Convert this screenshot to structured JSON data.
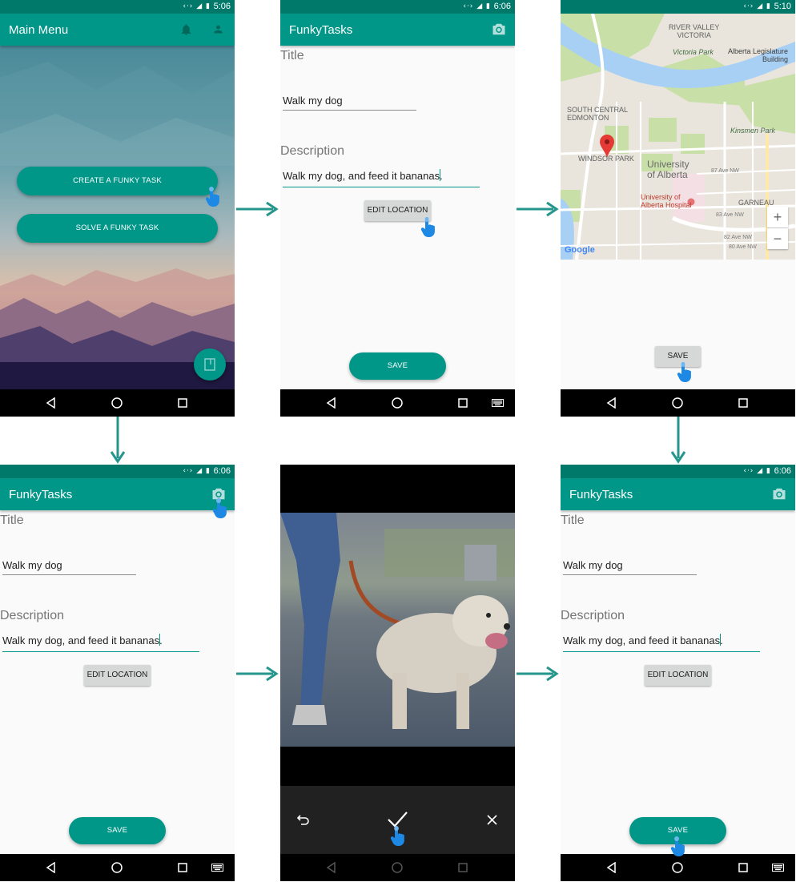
{
  "status": {
    "time_main_menu": "5:06",
    "time_task": "6:06",
    "time_map": "5:10"
  },
  "main_menu": {
    "title": "Main Menu",
    "bell_icon": "bell-icon",
    "account_icon": "account-icon",
    "create_label": "CREATE A FUNKY TASK",
    "solve_label": "SOLVE A FUNKY TASK",
    "fab_icon": "book-icon"
  },
  "task_form": {
    "app_title": "FunkyTasks",
    "camera_icon": "camera-icon",
    "title_label": "Title",
    "title_value": "Walk my dog",
    "description_label": "Description",
    "description_value": "Walk my dog, and feed it bananas.",
    "edit_location_label": "EDIT LOCATION",
    "save_label": "SAVE"
  },
  "map": {
    "labels": {
      "river_valley": "RIVER VALLEY\nVICTORIA",
      "victoria_park": "Victoria Park",
      "legislature": "Alberta Legislature\nBuilding",
      "south_central": "SOUTH CENTRAL\nEDMONTON",
      "kinsmen": "Kinsmen Park",
      "windsor": "WINDSOR PARK",
      "university": "University\nof Alberta",
      "hospital": "University of\nAlberta Hospital",
      "garneau": "GARNEAU",
      "ave87": "87 Ave NW",
      "ave83": "83 Ave NW",
      "ave82": "82 Ave NW",
      "ave80": "80 Ave NW",
      "google": "Google"
    },
    "zoom_in": "+",
    "zoom_out": "−",
    "save_label": "SAVE"
  },
  "camera": {
    "retake_icon": "undo-icon",
    "confirm_icon": "check-icon",
    "cancel_icon": "close-icon"
  },
  "colors": {
    "primary": "#009688",
    "primary_dark": "#00796b",
    "arrow": "#26968c"
  }
}
